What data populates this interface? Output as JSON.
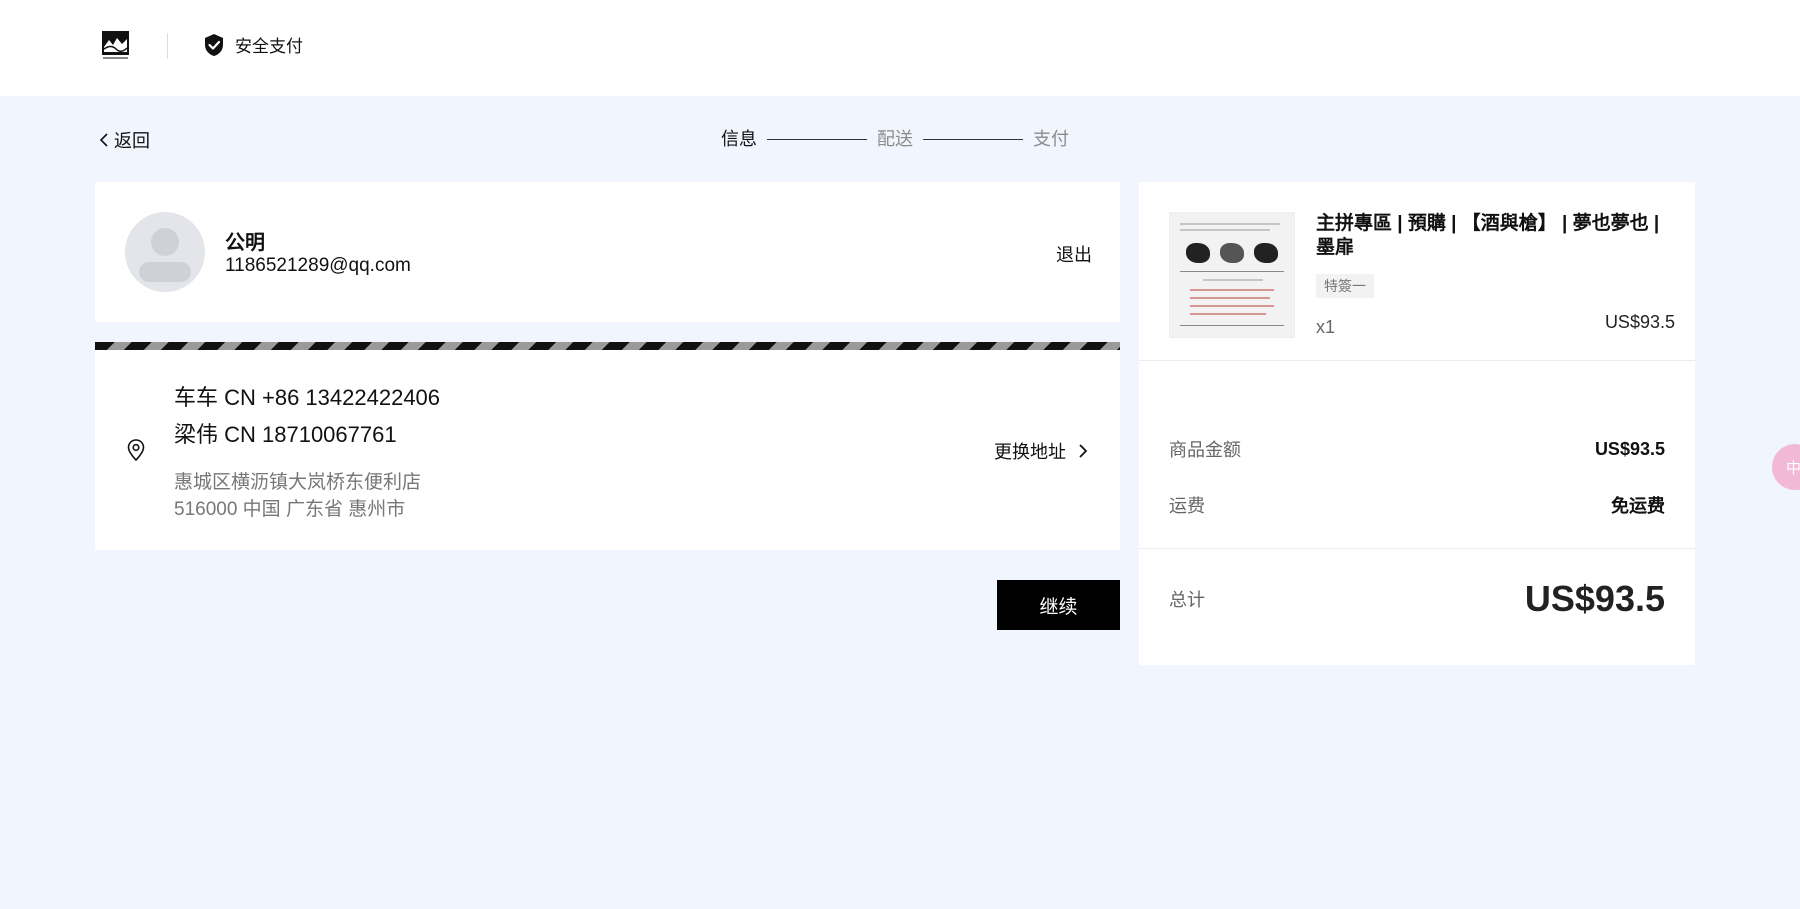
{
  "header": {
    "secure_label": "安全支付"
  },
  "nav": {
    "back_label": "返回",
    "steps": [
      {
        "label": "信息",
        "state": "active"
      },
      {
        "label": "配送",
        "state": "inactive"
      },
      {
        "label": "支付",
        "state": "inactive"
      }
    ]
  },
  "user": {
    "name": "公明",
    "email": "1186521289@qq.com",
    "logout_label": "退出"
  },
  "address": {
    "line1": "车车  CN +86 13422422406",
    "line2": "梁伟  CN 18710067761",
    "street": "惠城区横沥镇大岚桥东便利店",
    "region": "516000 中国 广东省 惠州市",
    "change_label": "更换地址"
  },
  "actions": {
    "continue_label": "继续"
  },
  "order": {
    "product_title": "主拼專區 | 預購 | 【酒與槍】 | 夢也夢也 | 墨扉",
    "variant": "特簽一",
    "quantity": "x1",
    "price": "US$93.5",
    "subtotal_label": "商品金额",
    "subtotal_value": "US$93.5",
    "shipping_label": "运费",
    "shipping_value": "免运费",
    "total_label": "总计",
    "total_value": "US$93.5"
  },
  "side_widget": {
    "label": "中"
  },
  "colors": {
    "page_bg": "#f1f5fd",
    "primary_button": "#000000",
    "side_widget": "#f2b9d6"
  }
}
